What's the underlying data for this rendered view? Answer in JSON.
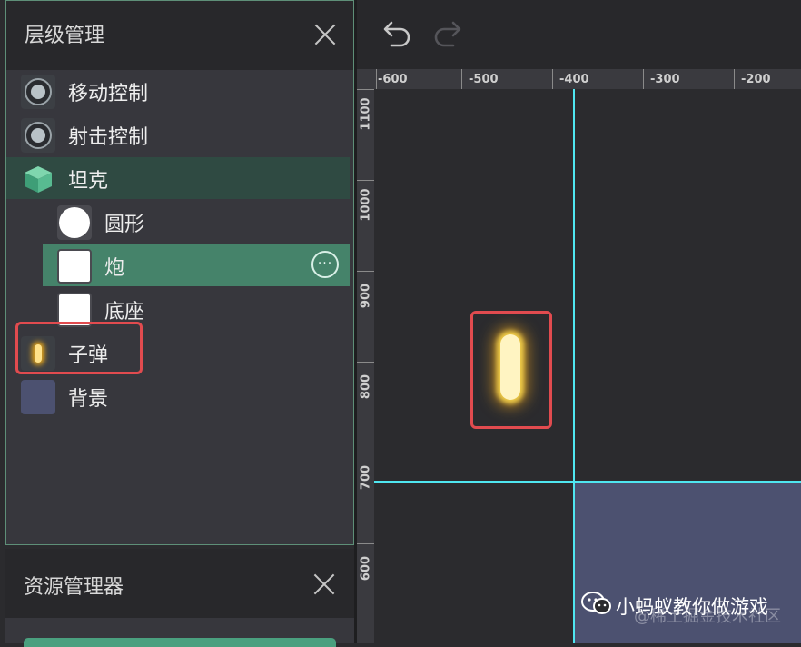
{
  "hierarchy_panel": {
    "title": "层级管理",
    "items": [
      {
        "label": "移动控制",
        "icon": "joystick-icon",
        "level": 0
      },
      {
        "label": "射击控制",
        "icon": "joystick-icon",
        "level": 0
      },
      {
        "label": "坦克",
        "icon": "cube-icon",
        "level": 0
      },
      {
        "label": "圆形",
        "icon": "circle-sprite-icon",
        "level": 1
      },
      {
        "label": "炮",
        "icon": "square-sprite-icon",
        "level": 1
      },
      {
        "label": "底座",
        "icon": "square-sprite-icon",
        "level": 1
      },
      {
        "label": "子弹",
        "icon": "bullet-sprite-icon",
        "level": 0
      },
      {
        "label": "背景",
        "icon": "background-sprite-icon",
        "level": 0
      }
    ],
    "selected_item": "炮",
    "more_button_glyph": "···"
  },
  "asset_panel": {
    "title": "资源管理器"
  },
  "scene": {
    "toolbar": {
      "undo_icon": "undo-icon",
      "redo_icon": "redo-icon"
    },
    "top_ruler_ticks": [
      "-600",
      "-500",
      "-400",
      "-300",
      "-200"
    ],
    "left_ruler_ticks": [
      "1100",
      "1000",
      "900",
      "800",
      "700",
      "600"
    ]
  },
  "watermark": {
    "text": "小蚂蚁教你做游戏",
    "subtext": "@稀土掘金技术社区"
  },
  "colors": {
    "selection": "#45836a",
    "highlight": "#e14b4f",
    "axis": "#4fe6f0",
    "background_sprite": "#4c5170"
  }
}
